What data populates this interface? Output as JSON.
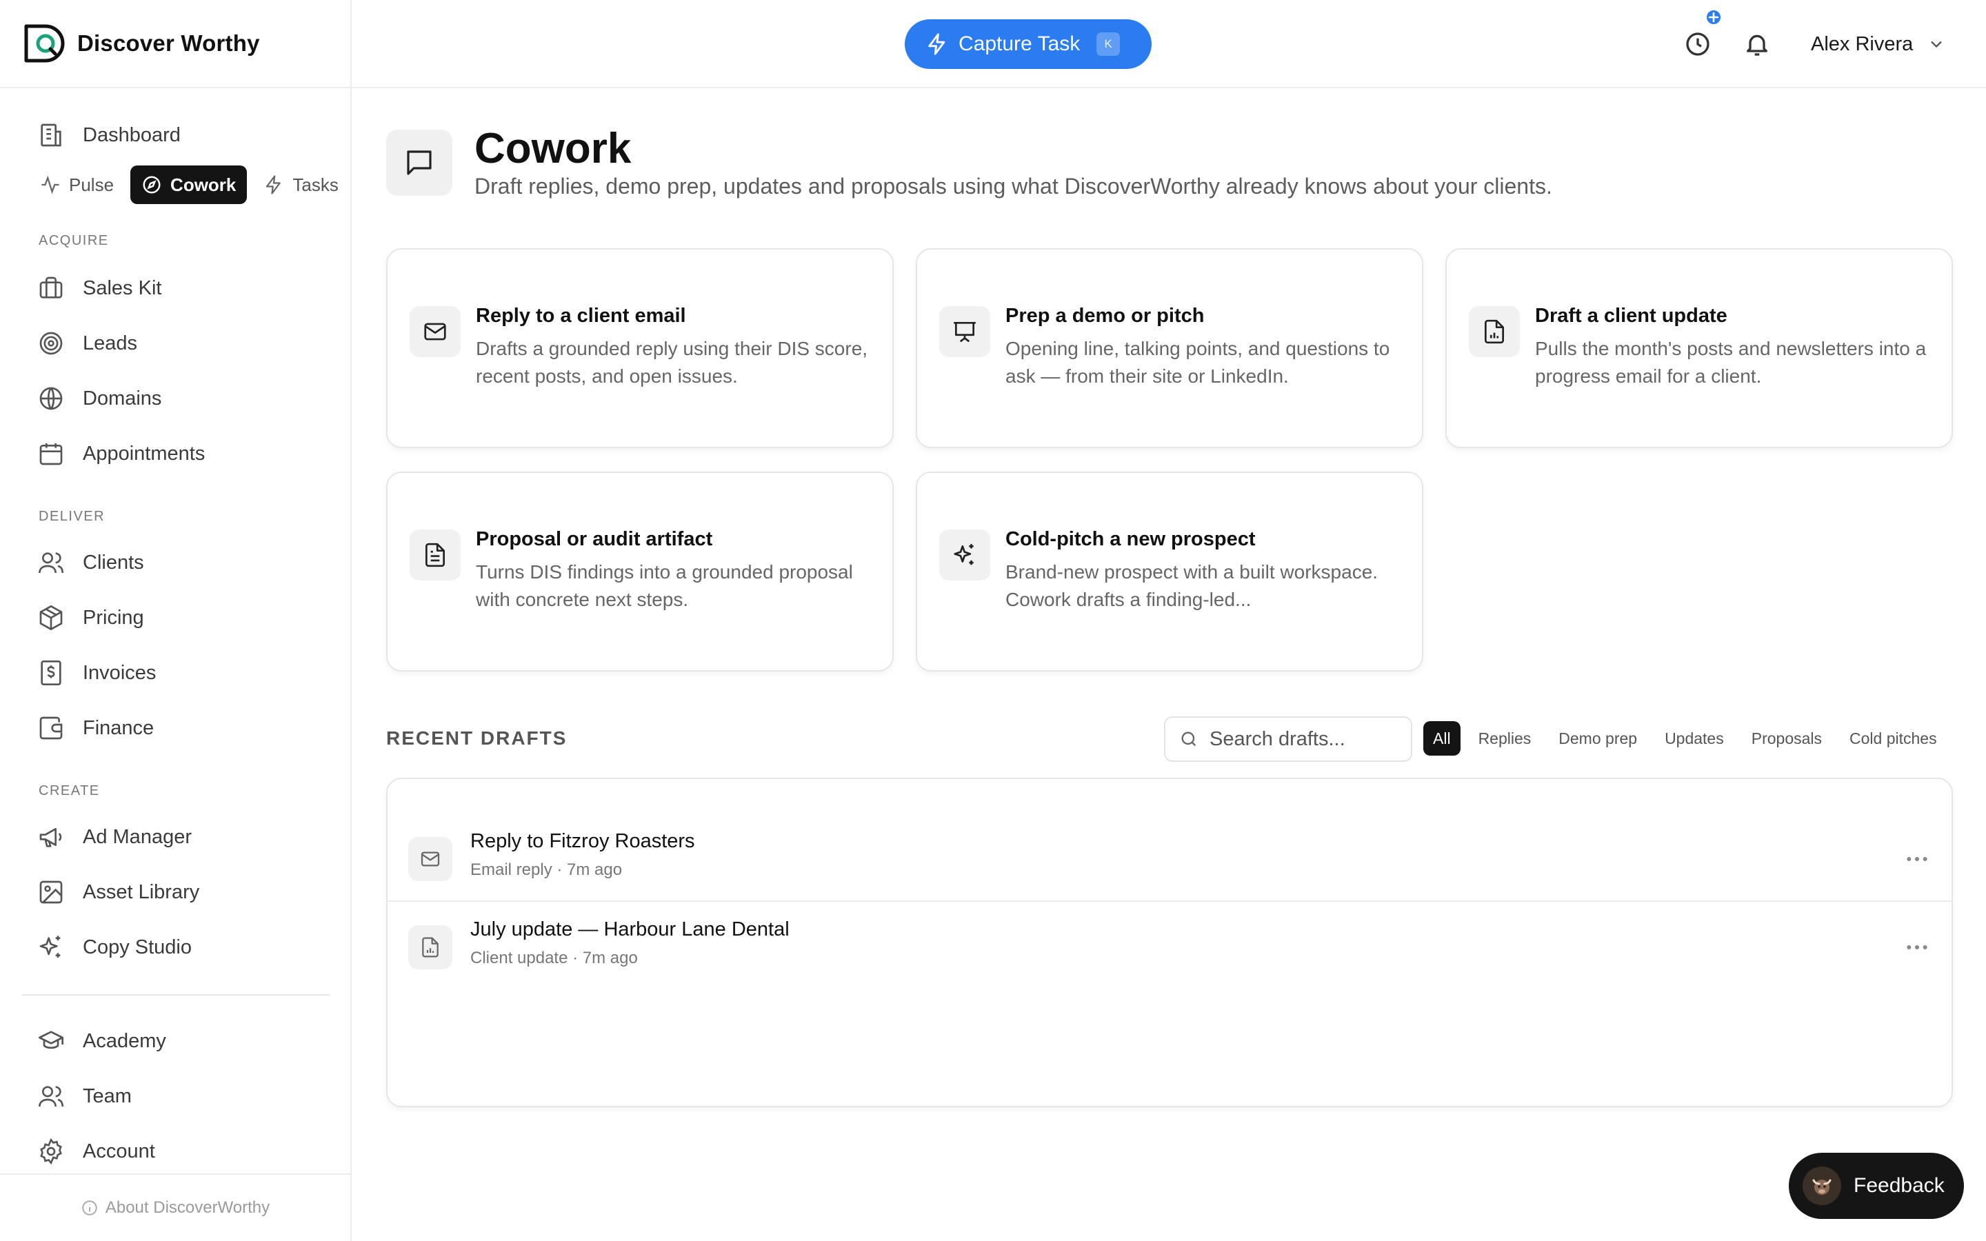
{
  "brand": {
    "name": "Discover Worthy"
  },
  "header": {
    "capture_label": "Capture Task",
    "capture_shortcut": "K",
    "user_name": "Alex Rivera"
  },
  "sidebar": {
    "dashboard": "Dashboard",
    "subtabs": [
      {
        "label": "Pulse",
        "icon": "activity-icon"
      },
      {
        "label": "Cowork",
        "icon": "compass-icon",
        "active": true
      },
      {
        "label": "Tasks",
        "icon": "bolt-icon"
      }
    ],
    "sections": {
      "acquire": "ACQUIRE",
      "deliver": "DELIVER",
      "create": "CREATE"
    },
    "acquire_items": [
      {
        "label": "Sales Kit",
        "icon": "briefcase-icon"
      },
      {
        "label": "Leads",
        "icon": "target-icon"
      },
      {
        "label": "Domains",
        "icon": "globe-icon"
      },
      {
        "label": "Appointments",
        "icon": "calendar-icon"
      }
    ],
    "deliver_items": [
      {
        "label": "Clients",
        "icon": "users-icon"
      },
      {
        "label": "Pricing",
        "icon": "package-icon"
      },
      {
        "label": "Invoices",
        "icon": "invoice-icon"
      },
      {
        "label": "Finance",
        "icon": "wallet-icon"
      }
    ],
    "create_items": [
      {
        "label": "Ad Manager",
        "icon": "megaphone-icon"
      },
      {
        "label": "Asset Library",
        "icon": "image-icon"
      },
      {
        "label": "Copy Studio",
        "icon": "sparkles-icon"
      }
    ],
    "bottom_items": [
      {
        "label": "Academy",
        "icon": "graduation-cap-icon"
      },
      {
        "label": "Team",
        "icon": "users-icon"
      },
      {
        "label": "Account",
        "icon": "gear-icon"
      }
    ],
    "about": "About DiscoverWorthy"
  },
  "page": {
    "title": "Cowork",
    "subtitle": "Draft replies, demo prep, updates and proposals using what DiscoverWorthy already knows about your clients."
  },
  "cards": [
    {
      "title": "Reply to a client email",
      "desc": "Drafts a grounded reply using their DIS score, recent posts, and open issues.",
      "icon": "mail-icon"
    },
    {
      "title": "Prep a demo or pitch",
      "desc": "Opening line, talking points, and questions to ask — from their site or LinkedIn.",
      "icon": "presentation-icon"
    },
    {
      "title": "Draft a client update",
      "desc": "Pulls the month's posts and newsletters into a progress email for a client.",
      "icon": "report-icon"
    },
    {
      "title": "Proposal or audit artifact",
      "desc": "Turns DIS findings into a grounded proposal with concrete next steps.",
      "icon": "document-icon"
    },
    {
      "title": "Cold-pitch a new prospect",
      "desc": "Brand-new prospect with a built workspace. Cowork drafts a finding-led...",
      "icon": "sparkles-icon"
    }
  ],
  "recent": {
    "label": "RECENT DRAFTS",
    "search_placeholder": "Search drafts...",
    "filters": [
      "All",
      "Replies",
      "Demo prep",
      "Updates",
      "Proposals",
      "Cold pitches"
    ],
    "active_filter": "All",
    "drafts": [
      {
        "title": "Reply to Fitzroy Roasters",
        "meta": "Email reply · 7m ago",
        "icon": "mail-icon"
      },
      {
        "title": "July update — Harbour Lane Dental",
        "meta": "Client update · 7m ago",
        "icon": "report-icon"
      }
    ]
  },
  "feedback": {
    "label": "Feedback"
  },
  "colors": {
    "accent": "#2b7cf0",
    "dark": "#141414"
  }
}
